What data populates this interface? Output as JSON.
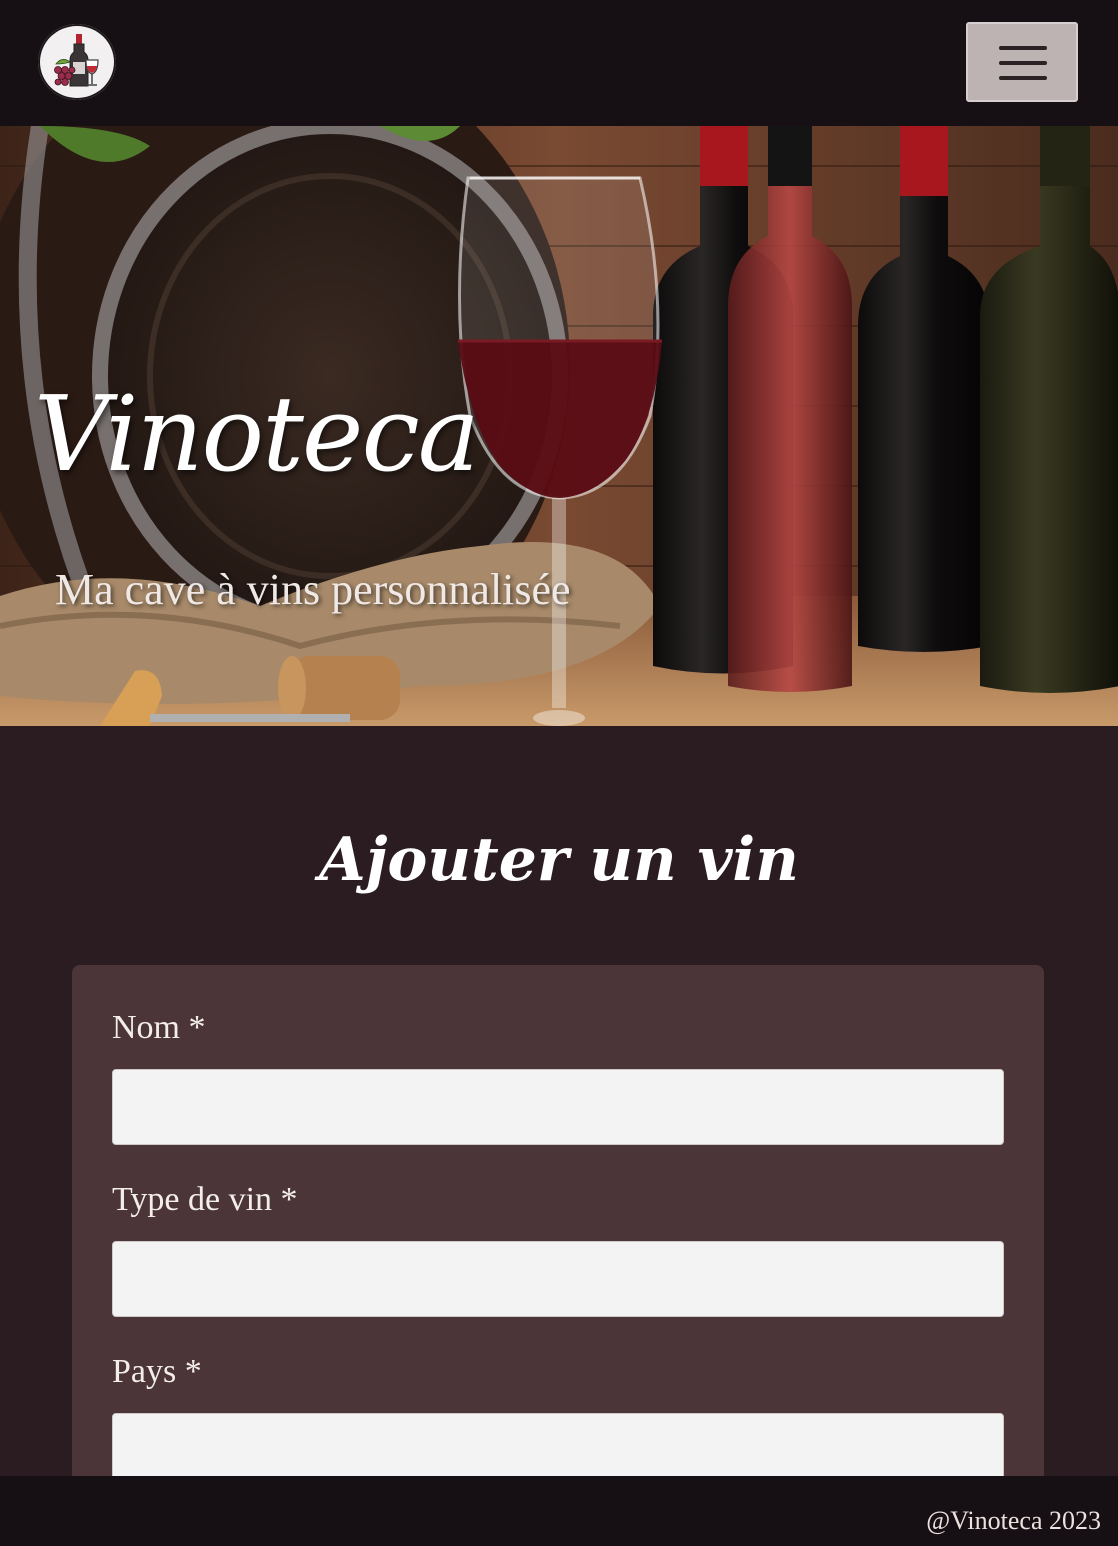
{
  "navbar": {
    "logo_icon": "wine-bottle-grapes-glass-icon",
    "menu_icon": "hamburger-menu-icon"
  },
  "hero": {
    "title": "Vinoteca",
    "subtitle": "Ma cave à vins personnalisée"
  },
  "form": {
    "title": "Ajouter un vin",
    "fields": [
      {
        "label": "Nom *",
        "value": "",
        "placeholder": ""
      },
      {
        "label": "Type de vin *",
        "value": "",
        "placeholder": ""
      },
      {
        "label": "Pays *",
        "value": "",
        "placeholder": ""
      }
    ]
  },
  "footer": {
    "text": "@Vinoteca 2023"
  },
  "colors": {
    "navbar_bg": "#161014",
    "page_bg": "#2a1c20",
    "card_bg": "#4b3538",
    "input_bg": "#f3f3f3",
    "menu_button_bg": "#bdb3b3"
  }
}
